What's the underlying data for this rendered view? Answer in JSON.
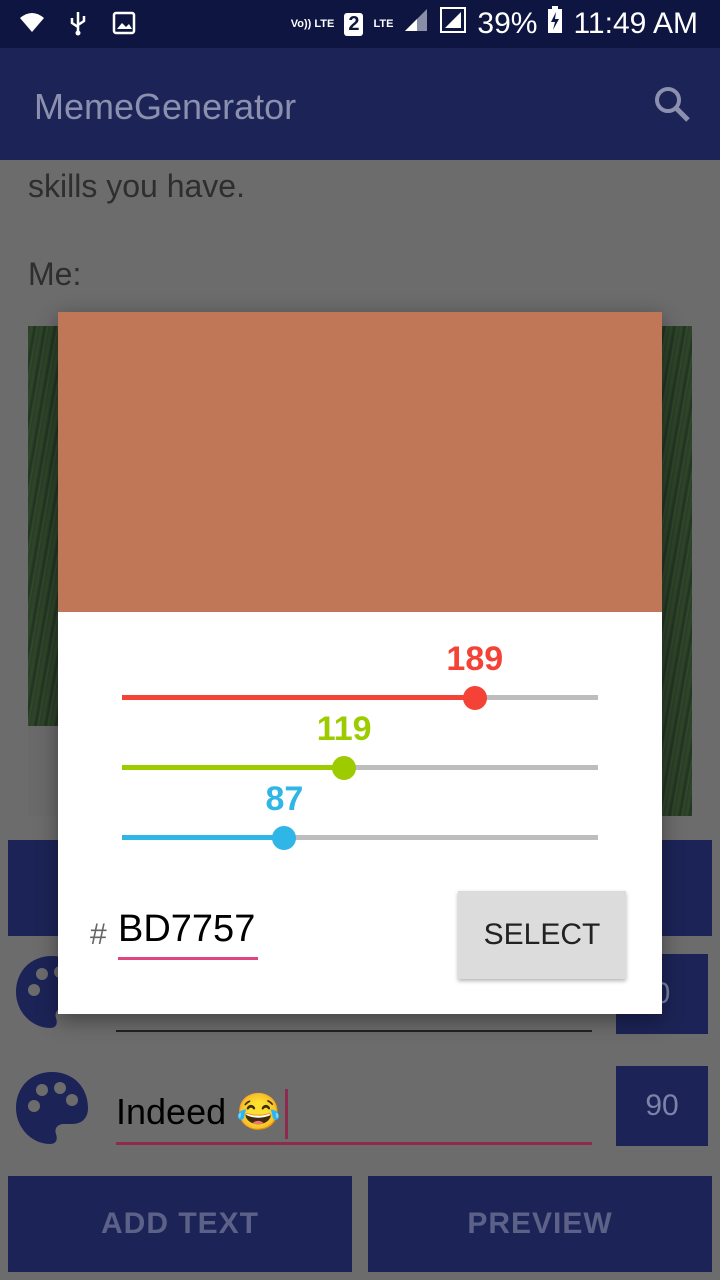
{
  "status_bar": {
    "time": "11:49 AM",
    "battery": "39%",
    "volte_label": "Vo)) LTE",
    "sim_slot": "2",
    "lte_label": "LTE"
  },
  "app_bar": {
    "title": "MemeGenerator"
  },
  "meme": {
    "caption_line1": "skills you have.",
    "caption_line2": "Me:"
  },
  "text_rows": [
    {
      "text": "",
      "size": "0"
    },
    {
      "text": "Indeed 😂",
      "size": "90"
    }
  ],
  "buttons": {
    "add_text": "ADD TEXT",
    "preview": "PREVIEW"
  },
  "color_dialog": {
    "preview_color": "#BF7757",
    "red": {
      "value": 189,
      "label": "189",
      "color": "#f44336"
    },
    "green": {
      "value": 119,
      "label": "119",
      "color": "#9ccc00"
    },
    "blue": {
      "value": 87,
      "label": "87",
      "color": "#2fb5e6"
    },
    "hash": "#",
    "hex_value": "BD7757",
    "select_label": "SELECT"
  }
}
